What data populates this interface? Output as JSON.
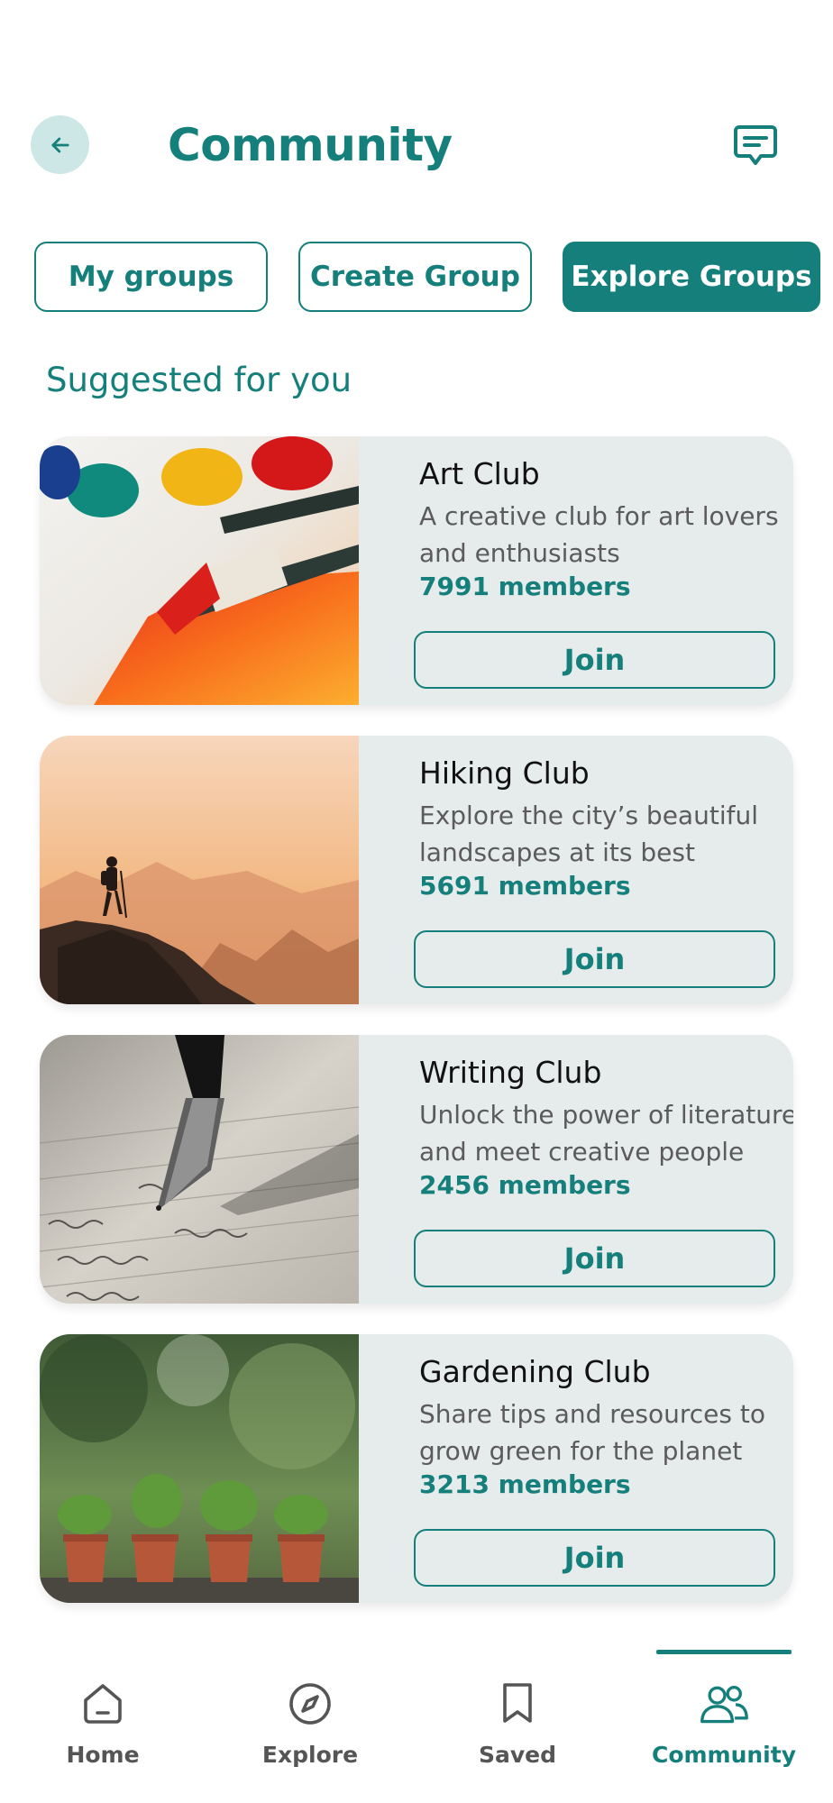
{
  "header": {
    "title": "Community",
    "back_icon": "arrow-left-icon",
    "chat_icon": "message-icon"
  },
  "segments": {
    "my_groups": "My groups",
    "create_group": "Create Group",
    "explore_groups": "Explore Groups",
    "active": "Explore Groups"
  },
  "section_title": "Suggested for you",
  "groups": [
    {
      "name": "Art Club",
      "desc_line1": "A creative club for art lovers",
      "desc_line2": "and enthusiasts",
      "members": "7991 members",
      "join": "Join"
    },
    {
      "name": "Hiking Club",
      "desc_line1": "Explore the city’s beautiful",
      "desc_line2": "landscapes at its best",
      "members": "5691 members",
      "join": "Join"
    },
    {
      "name": "Writing Club",
      "desc_line1": "Unlock the power of literature",
      "desc_line2": "and meet creative people",
      "members": "2456 members",
      "join": "Join"
    },
    {
      "name": "Gardening Club",
      "desc_line1": "Share tips and resources to",
      "desc_line2": "grow green for the planet",
      "members": "3213 members",
      "join": "Join"
    }
  ],
  "nav": {
    "home": "Home",
    "explore": "Explore",
    "saved": "Saved",
    "community": "Community",
    "active": "Community"
  },
  "colors": {
    "accent": "#157f7b",
    "card_bg": "#e6ebeb",
    "back_bg": "#cde7e7"
  }
}
